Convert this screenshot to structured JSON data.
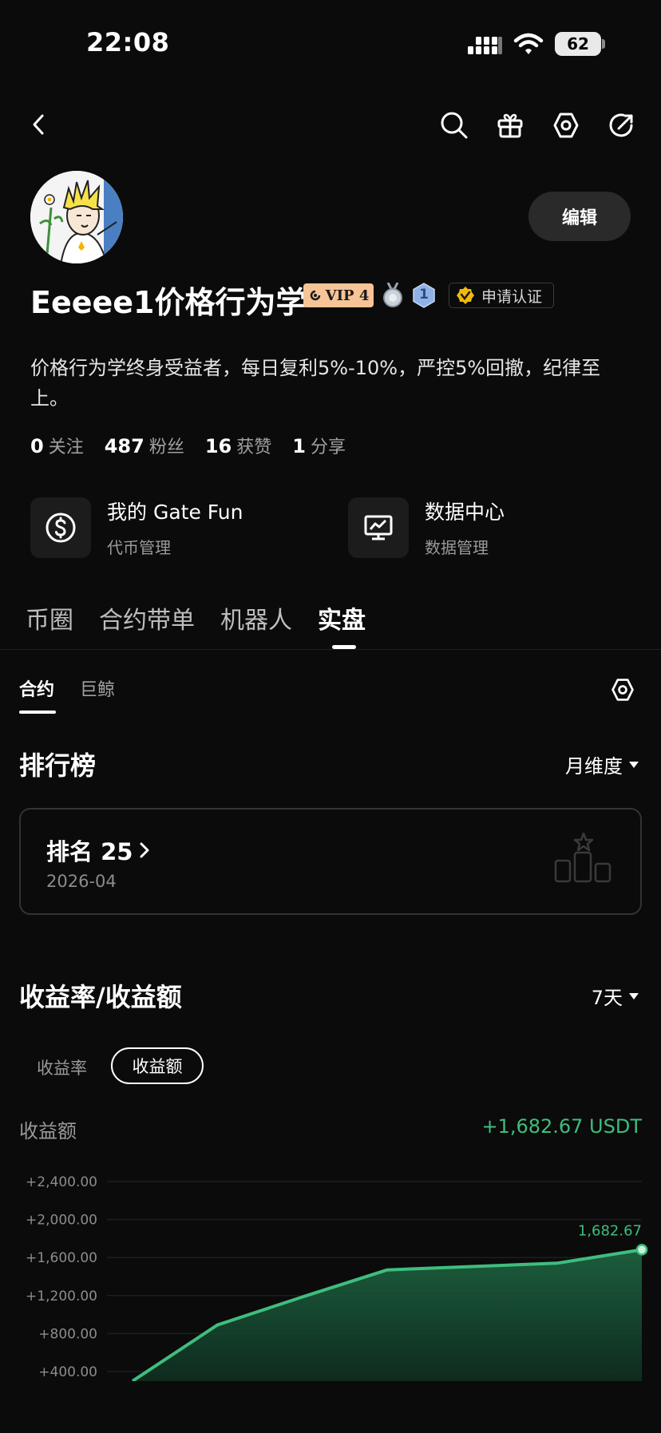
{
  "status_bar": {
    "time": "22:08",
    "battery": "62"
  },
  "header": {
    "icons": [
      "back-icon",
      "search-icon",
      "gift-icon",
      "settings-icon",
      "share-icon"
    ]
  },
  "profile": {
    "edit_label": "编辑",
    "name": "Eeeee1价格行为学",
    "vip_label": "VIP 4",
    "level": "1",
    "verify_label": "申请认证",
    "bio": "价格行为学终身受益者，每日复利5%-10%，严控5%回撤，纪律至上。",
    "stats": [
      {
        "value": "0",
        "label": "关注"
      },
      {
        "value": "487",
        "label": "粉丝"
      },
      {
        "value": "16",
        "label": "获赞"
      },
      {
        "value": "1",
        "label": "分享"
      }
    ]
  },
  "cards": [
    {
      "title": "我的 Gate Fun",
      "subtitle": "代币管理",
      "icon": "dollar-coin-icon"
    },
    {
      "title": "数据中心",
      "subtitle": "数据管理",
      "icon": "monitor-chart-icon"
    }
  ],
  "tabs": [
    {
      "label": "币圈"
    },
    {
      "label": "合约带单"
    },
    {
      "label": "机器人"
    },
    {
      "label": "实盘",
      "active": true
    }
  ],
  "subtabs": [
    {
      "label": "合约",
      "active": true
    },
    {
      "label": "巨鲸"
    }
  ],
  "ranking": {
    "title": "排行榜",
    "period": "月维度",
    "rank_label": "排名 25",
    "date": "2026-04"
  },
  "returns": {
    "title": "收益率/收益额",
    "period": "7天",
    "segments": [
      "收益率",
      "收益额"
    ],
    "active_segment": "收益额",
    "metric_label": "收益额",
    "metric_value": "+1,682.67 USDT"
  },
  "colors": {
    "accent_green": "#3fbd7e",
    "vip_bg": "#f6c497",
    "verify_gold": "#f0b90b"
  },
  "chart_data": {
    "type": "area",
    "y_ticks": [
      "+2,400.00",
      "+2,000.00",
      "+1,600.00",
      "+1,200.00",
      "+800.00",
      "+400.00"
    ],
    "ylim": [
      400,
      2400
    ],
    "x": [
      1,
      2,
      3,
      4,
      5,
      6,
      7
    ],
    "values": [
      300,
      890,
      1185,
      1470,
      1505,
      1540,
      1682.67
    ],
    "end_label": "1,682.67",
    "grid": true
  }
}
